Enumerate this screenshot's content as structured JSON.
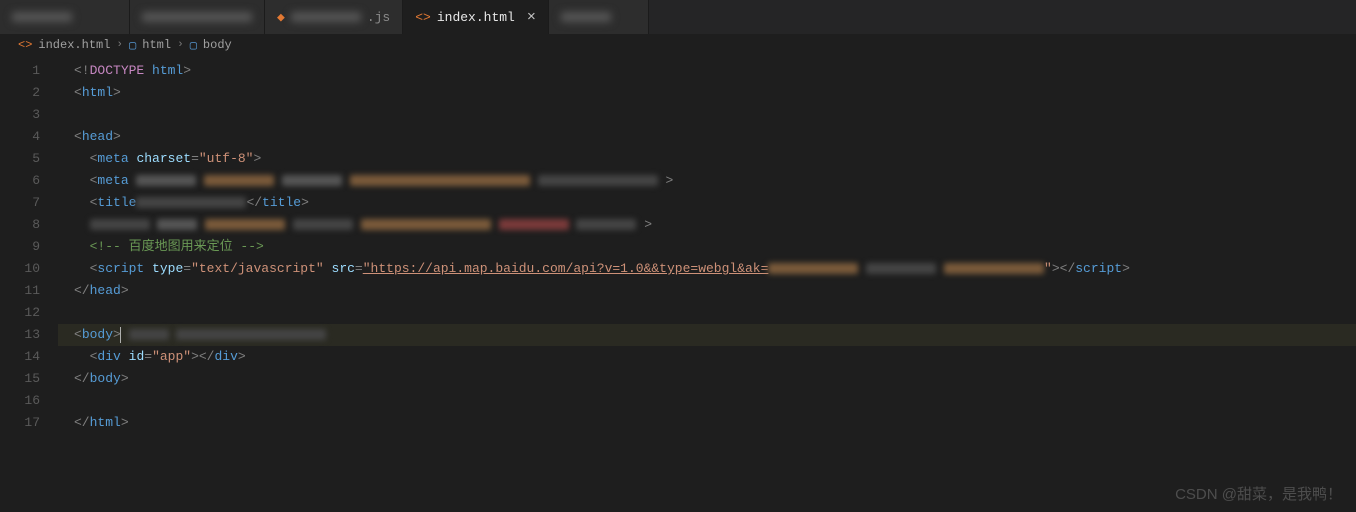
{
  "tabs": [
    {
      "label": "",
      "blurred": true,
      "active": false
    },
    {
      "label": "",
      "blurred": true,
      "active": false
    },
    {
      "label": ".js",
      "blurred": true,
      "active": false,
      "prefixBlur": true
    },
    {
      "label": "index.html",
      "blurred": false,
      "active": true,
      "close": "×"
    },
    {
      "label": "",
      "blurred": true,
      "active": false
    }
  ],
  "breadcrumbs": {
    "file": "index.html",
    "parts": [
      "html",
      "body"
    ]
  },
  "lines": {
    "count": 17,
    "l1_doctype": "DOCTYPE",
    "l1_html": "html",
    "l2_html": "html",
    "l4_head": "head",
    "l5_meta": "meta",
    "l5_attr": "charset",
    "l5_val": "\"utf-8\"",
    "l6_meta": "meta",
    "l7_title_o": "title",
    "l7_title_c": "title",
    "l9_comment": "<!-- 百度地图用来定位 -->",
    "l10_script": "script",
    "l10_type_attr": "type",
    "l10_type_val": "\"text/javascript\"",
    "l10_src_attr": "src",
    "l10_src_val_a": "\"https://api.map.baidu.com/api?v=1.0&&type=webgl&ak=",
    "l10_src_val_b": "\"",
    "l10_script_c": "script",
    "l11_head_c": "head",
    "l13_body": "body",
    "l14_div": "div",
    "l14_id_attr": "id",
    "l14_id_val": "\"app\"",
    "l14_div_c": "div",
    "l15_body_c": "body",
    "l17_html_c": "html"
  },
  "watermark": "CSDN @甜菜，是我鸭！"
}
